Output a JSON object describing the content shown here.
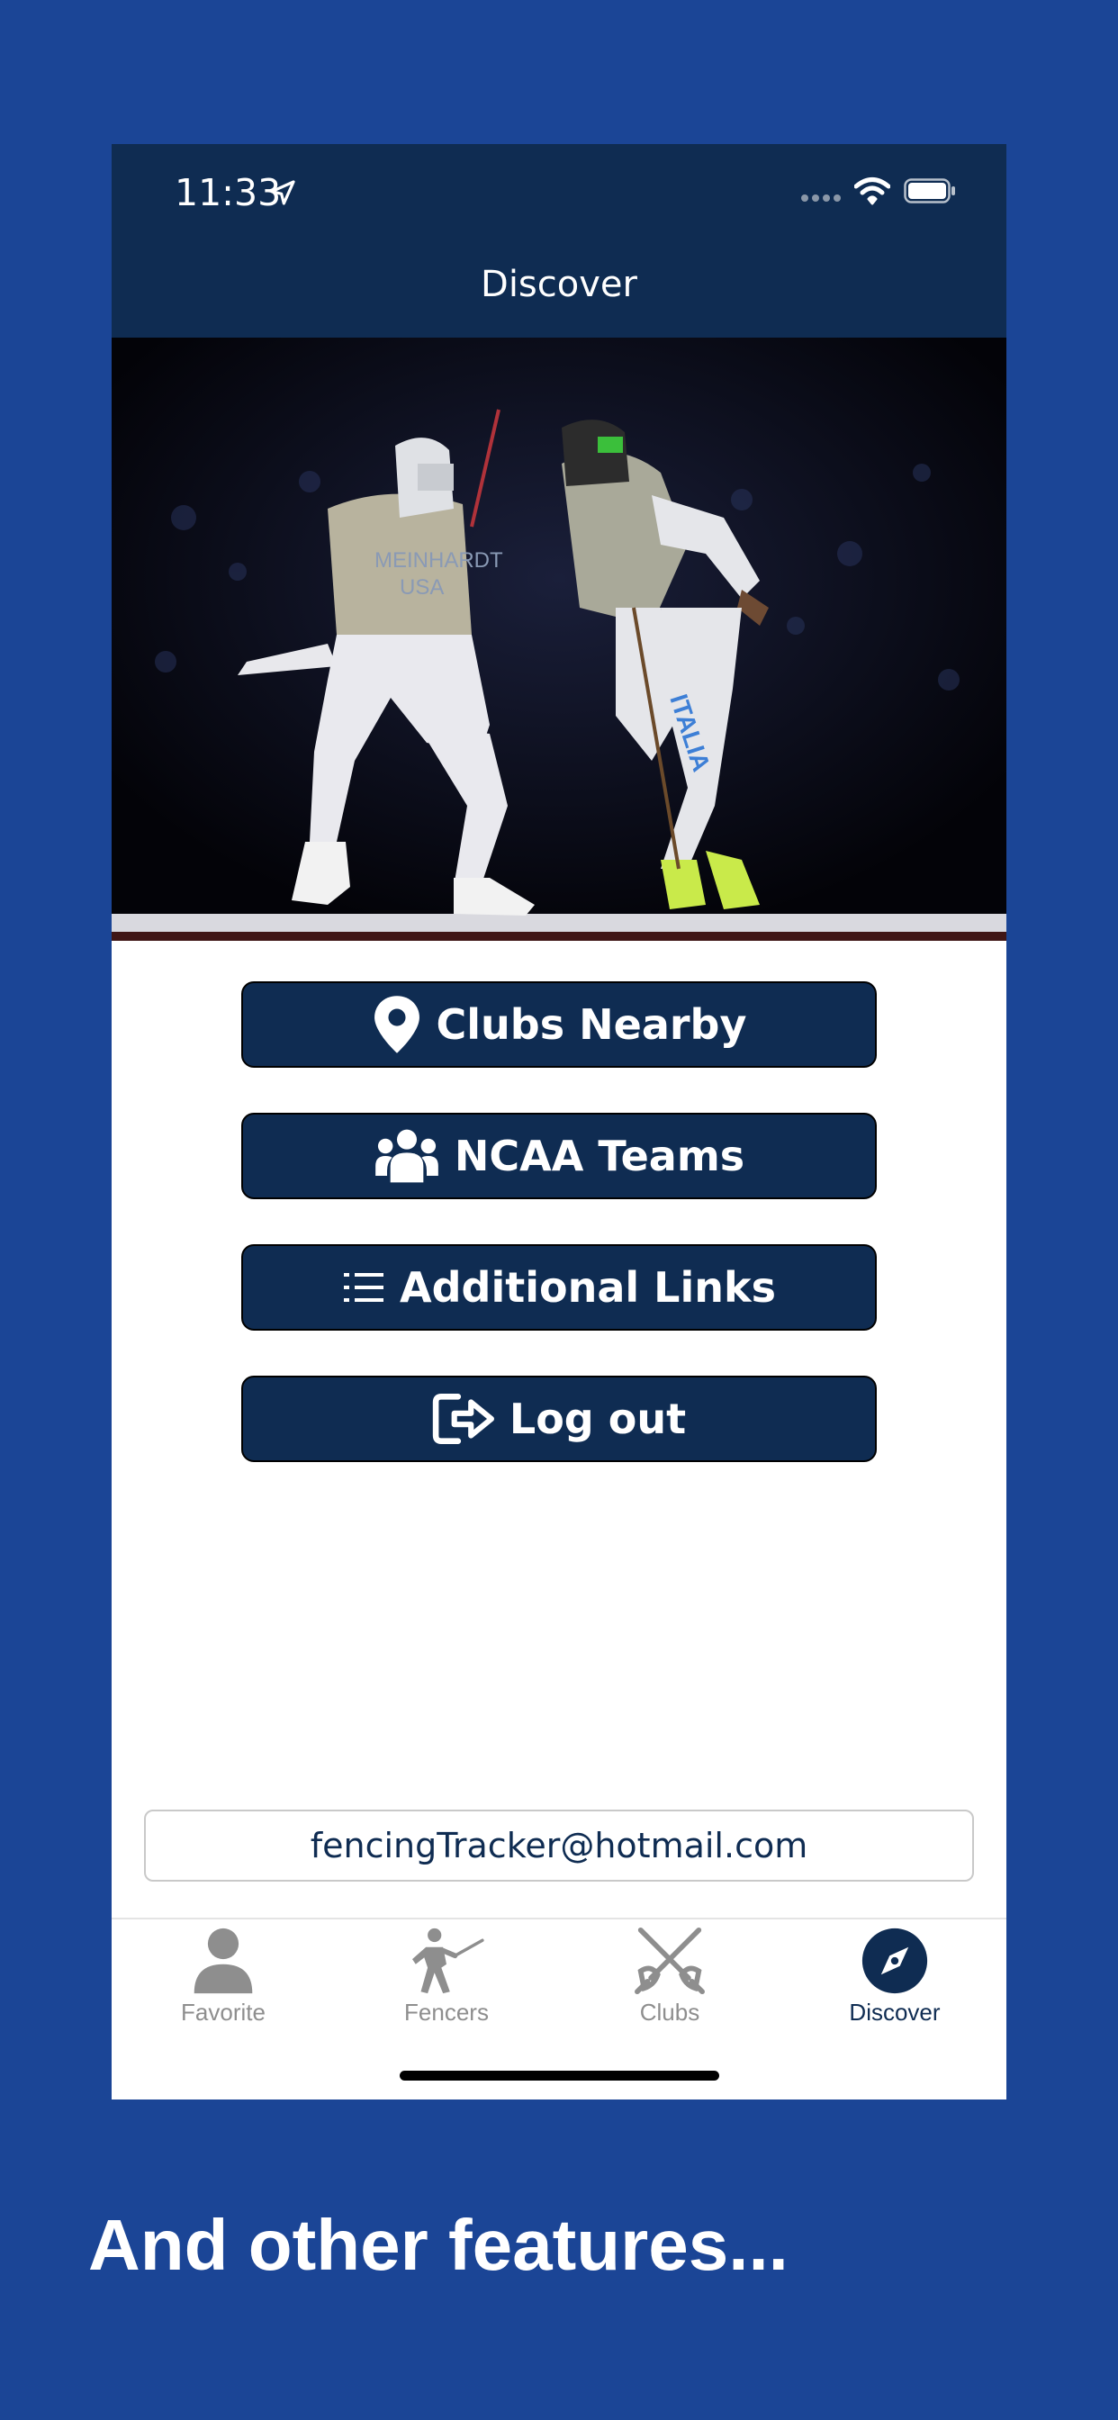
{
  "status_bar": {
    "time": "11:33"
  },
  "nav": {
    "title": "Discover"
  },
  "buttons": [
    {
      "label": "Clubs Nearby",
      "icon": "location-pin-icon"
    },
    {
      "label": "NCAA Teams",
      "icon": "users-group-icon"
    },
    {
      "label": "Additional Links",
      "icon": "list-icon"
    },
    {
      "label": "Log out",
      "icon": "logout-icon"
    }
  ],
  "email": "fencingTracker@hotmail.com",
  "tabs": [
    {
      "label": "Favorite",
      "icon": "person-icon",
      "active": false
    },
    {
      "label": "Fencers",
      "icon": "fencer-icon",
      "active": false
    },
    {
      "label": "Clubs",
      "icon": "crossed-swords-icon",
      "active": false
    },
    {
      "label": "Discover",
      "icon": "compass-icon",
      "active": true
    }
  ],
  "hero": {
    "fencer_left_lettering": "MEINHARDT USA",
    "fencer_right_lettering": "ITALIA"
  },
  "caption": "And other features...",
  "colors": {
    "background": "#1b4596",
    "navy": "#0f2c52",
    "tab_inactive": "#8e8e8e"
  }
}
